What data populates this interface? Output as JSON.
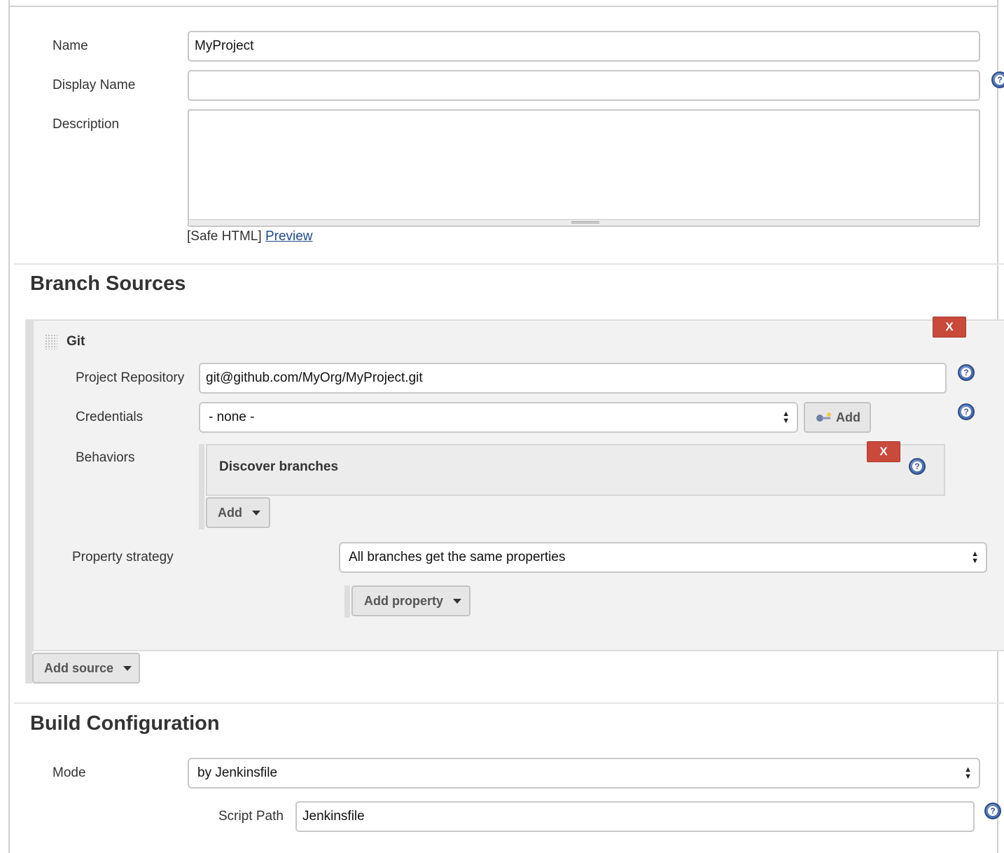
{
  "general": {
    "name_label": "Name",
    "name_value": "MyProject",
    "display_name_label": "Display Name",
    "display_name_value": "",
    "description_label": "Description",
    "description_value": "",
    "safe_html_text": "[Safe HTML]",
    "preview_link": "Preview"
  },
  "branch_sources": {
    "title": "Branch Sources",
    "git": {
      "title": "Git",
      "remove_label": "X",
      "project_repository_label": "Project Repository",
      "project_repository_value": "git@github.com/MyOrg/MyProject.git",
      "credentials_label": "Credentials",
      "credentials_value": "- none -",
      "credentials_add_label": "Add",
      "behaviors_label": "Behaviors",
      "behaviors": [
        {
          "label": "Discover branches",
          "remove_label": "X"
        }
      ],
      "behaviors_add_label": "Add",
      "property_strategy_label": "Property strategy",
      "property_strategy_value": "All branches get the same properties",
      "add_property_label": "Add property"
    },
    "add_source_label": "Add source"
  },
  "build_configuration": {
    "title": "Build Configuration",
    "mode_label": "Mode",
    "mode_value": "by Jenkinsfile",
    "script_path_label": "Script Path",
    "script_path_value": "Jenkinsfile"
  },
  "icons": {
    "help": "help-icon",
    "drag_handle": "drag-handle-icon",
    "key": "key-icon",
    "dropdown": "caret-down-icon"
  },
  "colors": {
    "remove_button": "#c9493b",
    "help_icon": "#4e73b4",
    "link": "#204a87",
    "panel_bg": "#f2f2f2"
  }
}
